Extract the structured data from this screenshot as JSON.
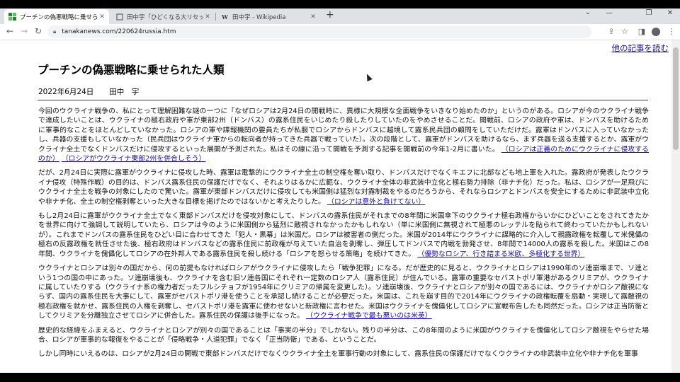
{
  "browser": {
    "tabs": [
      {
        "title": "プーチンの偽悪戦略に乗せられた人類",
        "icon": "site-favicon",
        "active": true
      },
      {
        "title": "田中宇「ひどくなる大リセット系の陳腐",
        "icon": "page-icon",
        "active": false
      },
      {
        "title": "田中宇 - Wikipedia",
        "icon": "wikipedia-icon",
        "active": false
      }
    ],
    "url": "tanakanews.com/220624russia.htm"
  },
  "page": {
    "other_articles_link": "他の記事を読む",
    "title": "プーチンの偽悪戦略に乗せられた人類",
    "date": "2022年6月24日",
    "author": "田中　宇",
    "paragraphs": [
      {
        "text": "今回のウクライナ戦争の、私にとって理解困難な謎の一つに「なぜロシアは2月24日の開戦時に、異様に大規模な全面戦争をいきなり始めたのか」というのがある。ロシアが今のウクライナ戦争で達成したいことは、ウクライナの極右政府や軍が東部2州（ドンバス）の露系住民をいじめたり殺したりしていたのをやめさせることだ。開戦前、ロシアの政府や軍は、ドンバスを助けるために軍事的なことをほとんどしていなかった。ロシアの軍や諜報機関の要員たちが私服でロシアからドンバスに越境して露系民兵団の顧問をしていただけだ。露軍はドンバスに入っていなかったし、兵器の支援もしていなかった（民兵団はウクライナ軍からの転向者が持ってきた兵器で戦っていた）。次の段階として、露軍がドンバスを助けるなら、まず兵器を送る支援するとか、露軍がウクライナ全土でなくドンバスだけに侵攻するといった展開が予測された。私はその線に沿って開戦を予測する記事を開戦前の今年1-2月に書いた。",
        "links": [
          "（ロシアは正義のためにウクライナに侵攻するのか）",
          "（ロシアがウクライナ東部2州を併合しそう）"
        ]
      },
      {
        "text": "だが、2月24日に実際に露軍がウクライナに侵攻した時、露軍は電撃的にウクライナ全土の制空権を奪い取り、ドンバスだけでなくキエフに北部なども地上軍を入れた。露政府が発表したウクライナ侵攻（特殊作戦）の目的は、ドンバス露系住民の保護だけでなく、それよりはるかに広範な、ウクライナ全体の非武装中立化と極右勢力排除（非ナチ化）だった。私は、ロシアが一足飛びにウクライナ全土を戦争の対象にしたので驚いた。露軍が東部ドンバスだけに侵攻しても米国側は猛烈な対露制裁をやるのだろうから、それならロシアとドンバスを安全にするために非武装中立化や非ナチ化、全土の制空権剥奪といった大きな目標を掲げたのではないかと考えたりした。",
        "links": [
          "（ロシアは意外と負けてない）"
        ]
      },
      {
        "text": "もし2月24日に露軍がウクライナ全土でなく東部ドンバスだけを侵攻対象にして、ドンバスの露系住民がそれまでの8年間に米国傘下のウクライナ極右政権からいかにひどいことをされてきたかを世界に向けて強調して説明していたら、ロシアは今のように米国側から猛烈に敵視されなかったかもしれない（単に米国側に無視されて極悪のレッテルを貼られて終わっていたかもしれないが）。これまでドンバスの露系住民をひどい目に合わせてきた「犯人・黒幕」は米国だ。ロシアは被害者の側だった。米国が2014年にウクライナに謀略的に介入して親露政権を転覆して米傀儡の極右の反露政権を就任させた後、極右政府はドンバスなどの露系住民に前政権が与えていた自治を剥奪し、弾圧してドンバスで内戦を勃発させ、8年間で14000人の露系を殺した。米国はこの8年間、ウクライナを傀儡化してロシアの在外邦人である露系住民を殺し続ける「ロシアを怒らせる策略」を続けてきた。",
        "links": [
          "（優勢なロシア、行き詰まる米欧、多極化する世界）"
        ]
      },
      {
        "text": "ウクライナとロシアは別々の国だから、何の前提もなければロシアがウクライナに侵攻したら「戦争犯罪」になる。だが歴史的に見ると、ウクライナとロシアは1990年のソ連崩壊まで、ソ連という1つの国の中にあった。ソ連崩壊後も、ウクライナを含む旧ソ連各国にそれぞれ一定数のロシア人（露系住民）が住んでいる。露軍の重要なセバストポリ軍港があるクリミアが、ウクライナに属していたりする（ウクライナ系の権力者だったフルシチョフが1954年にクリミアの帰属を変更した）。ソ連崩壊後、ウクライナとロシアが別々の国であるには、ウクライナがロシア敵視にならず、国内の露系住民を大事にして、露軍がセバストポリ港を使うことを承認し続けることが必要だった。米国は、これを崩す目的で2014年にウクライナの政権転覆を扇動・実現して露敵視の極右政権を就かせ、露系住民の人権を剥奪し、セバストポリ港を露軍に使わせないと新政権に言わせた。米国はウクライナを傀儡化してロシアに宣戦布告したも同然だった。ロシアは正当防衛としてクリミアを分離独立させてロシアに併合した。露系住民の保護は後手になった。",
        "links": [
          "（ウクライナ戦争で最も悪いのは米英）"
        ]
      },
      {
        "text": "歴史的な経緯をふまえると、ウクライナとロシアが別々の国であることは「事実の半分」でしかない。残りの半分は、この8年間のように米国がウクライナを傀儡化してロシア敵視をやらせた場合、ロシアが軍事的な報復をやることが「侵略戦争・人道犯罪」でなく「正当防衛」である、ということだ。",
        "links": []
      },
      {
        "text": "しかし同時にいえるのは、ロシアが2月24日の開戦で東部ドンバスだけでなくウクライナ全土を軍事行動の対象にして、露系住民の保護だけでなくウクライナの非武装中立化や非ナチ化を軍事",
        "links": []
      }
    ]
  },
  "colors": {
    "link": "#1a0dab",
    "rule": "#8b1c1c",
    "tabstrip": "#dee1e6"
  }
}
